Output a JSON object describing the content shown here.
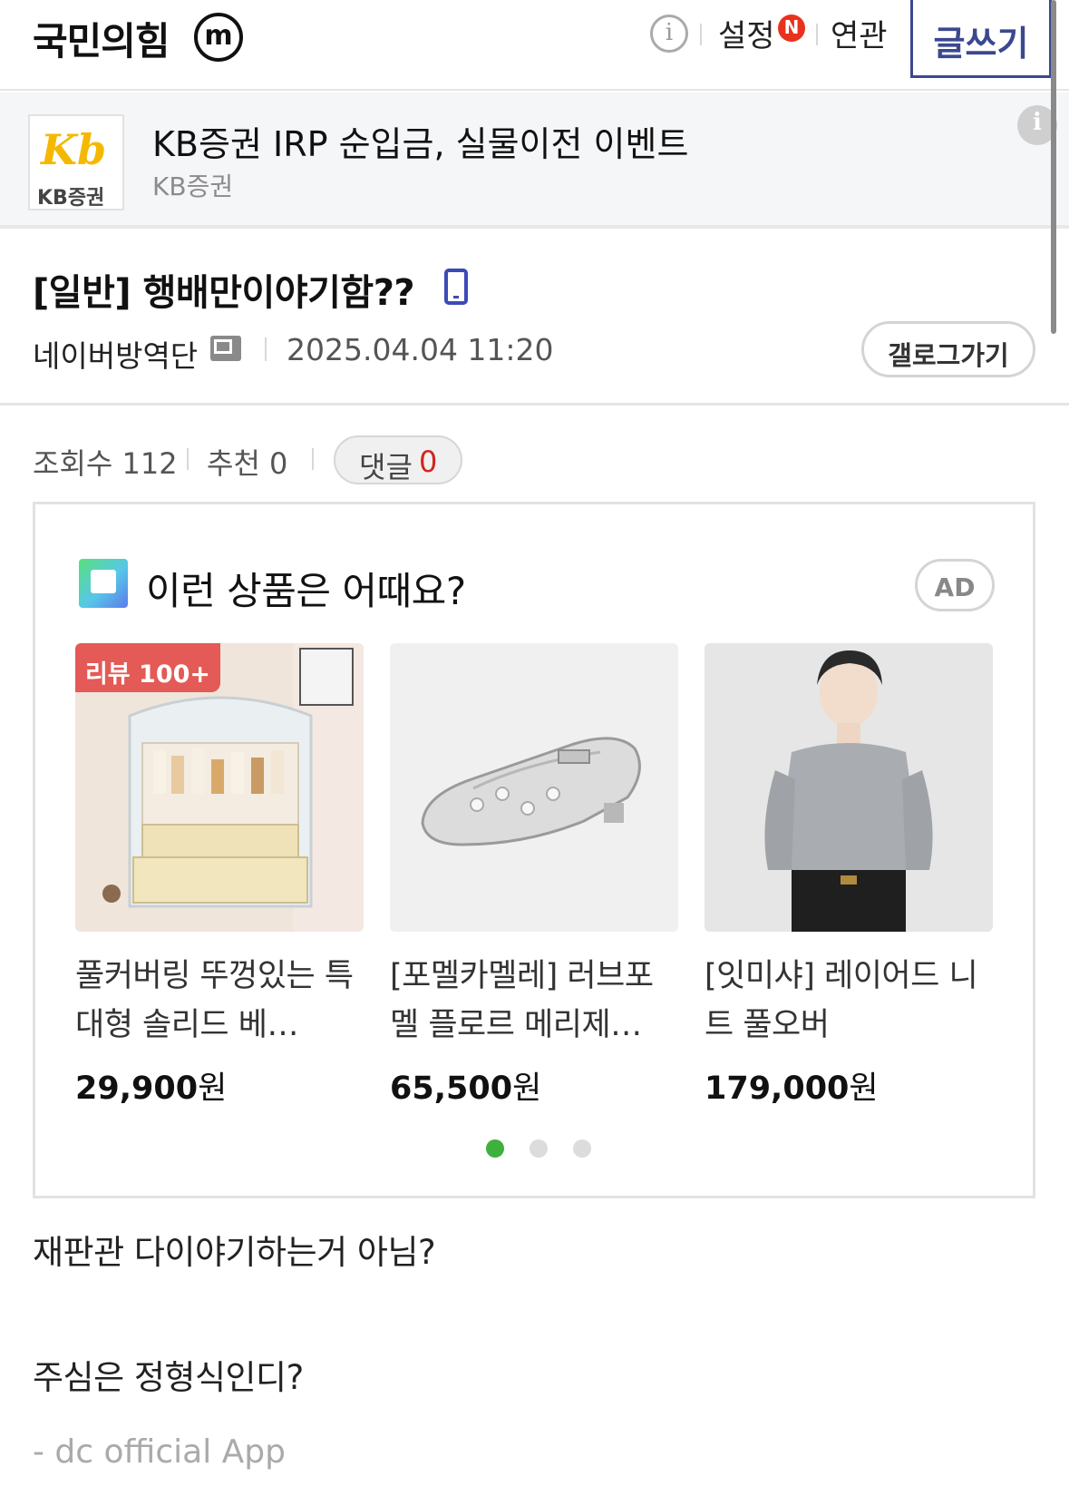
{
  "header": {
    "gallery_name": "국민의힘",
    "minor_badge": "m",
    "info_icon": "info-icon",
    "settings_label": "설정",
    "settings_new_badge": "N",
    "related_label": "연관",
    "write_button": "글쓰기"
  },
  "ad_banner": {
    "logo_glyph": "Kb",
    "logo_text": "KB증권",
    "title": "KB증권 IRP 순입금, 실물이전 이벤트",
    "advertiser": "KB증권",
    "info_icon": "info-icon"
  },
  "post": {
    "title": "[일반] 행배만이야기함??",
    "device_icon": "mobile-icon",
    "author": "네이버방역단",
    "author_icon": "fixed-nick-icon",
    "date": "2025.04.04 11:20",
    "gallery_go_button": "갤로그가기"
  },
  "stats": {
    "views_label": "조회수 112",
    "recommend_label": "추천 0",
    "comments_label": "댓글",
    "comments_count": "0"
  },
  "product_ad": {
    "title": "이런 상품은 어때요?",
    "ad_label": "AD",
    "products": [
      {
        "name": "풀커버링 뚜껑있는 특대형 솔리드 베…",
        "price": "29,900",
        "currency": "원",
        "badge": "리뷰 100+"
      },
      {
        "name": "[포멜카멜레] 러브포멜 플로르 메리제…",
        "price": "65,500",
        "currency": "원"
      },
      {
        "name": "[잇미샤] 레이어드 니트 풀오버",
        "price": "179,000",
        "currency": "원"
      }
    ],
    "pager": {
      "count": 3,
      "active": 0
    },
    "colors": {
      "pager_active": "#3db03d",
      "pager_inactive": "#dcdcdc"
    }
  },
  "body": {
    "lines": [
      "재판관 다이야기하는거 아님?",
      "주심은 정형식인디?"
    ],
    "signature": "- dc official App"
  },
  "colors": {
    "accent": "#3b4890",
    "new_badge": "#e8321e",
    "comment_count": "#d0261e",
    "review_badge": "#e35a56"
  }
}
